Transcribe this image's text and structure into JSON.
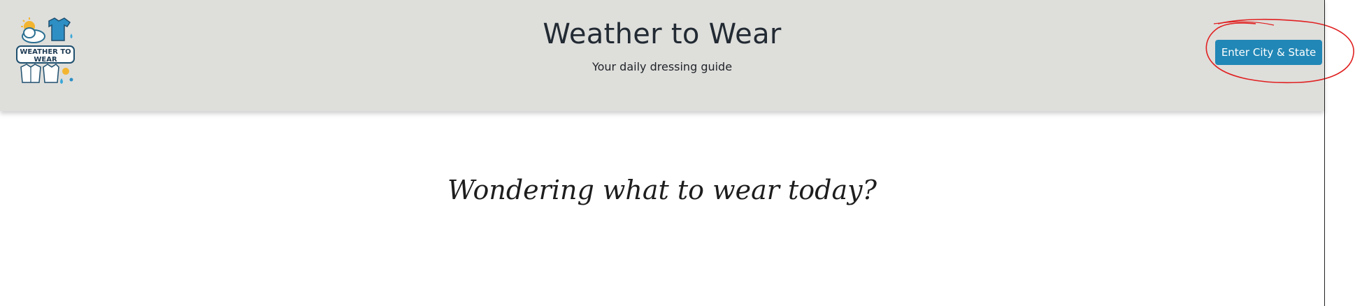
{
  "header": {
    "title": "Weather to Wear",
    "subtitle": "Your daily dressing guide",
    "logo": {
      "text_line1": "WEATHER TO",
      "text_line2": "WEAR",
      "icon": "weather-clothing-logo"
    },
    "city_button_label": "Enter City & State"
  },
  "main": {
    "tagline": "Wondering what to wear today?"
  },
  "colors": {
    "header_bg": "#dededb",
    "button_bg": "#2187b6",
    "annotation": "#e02020",
    "title": "#222a33"
  }
}
